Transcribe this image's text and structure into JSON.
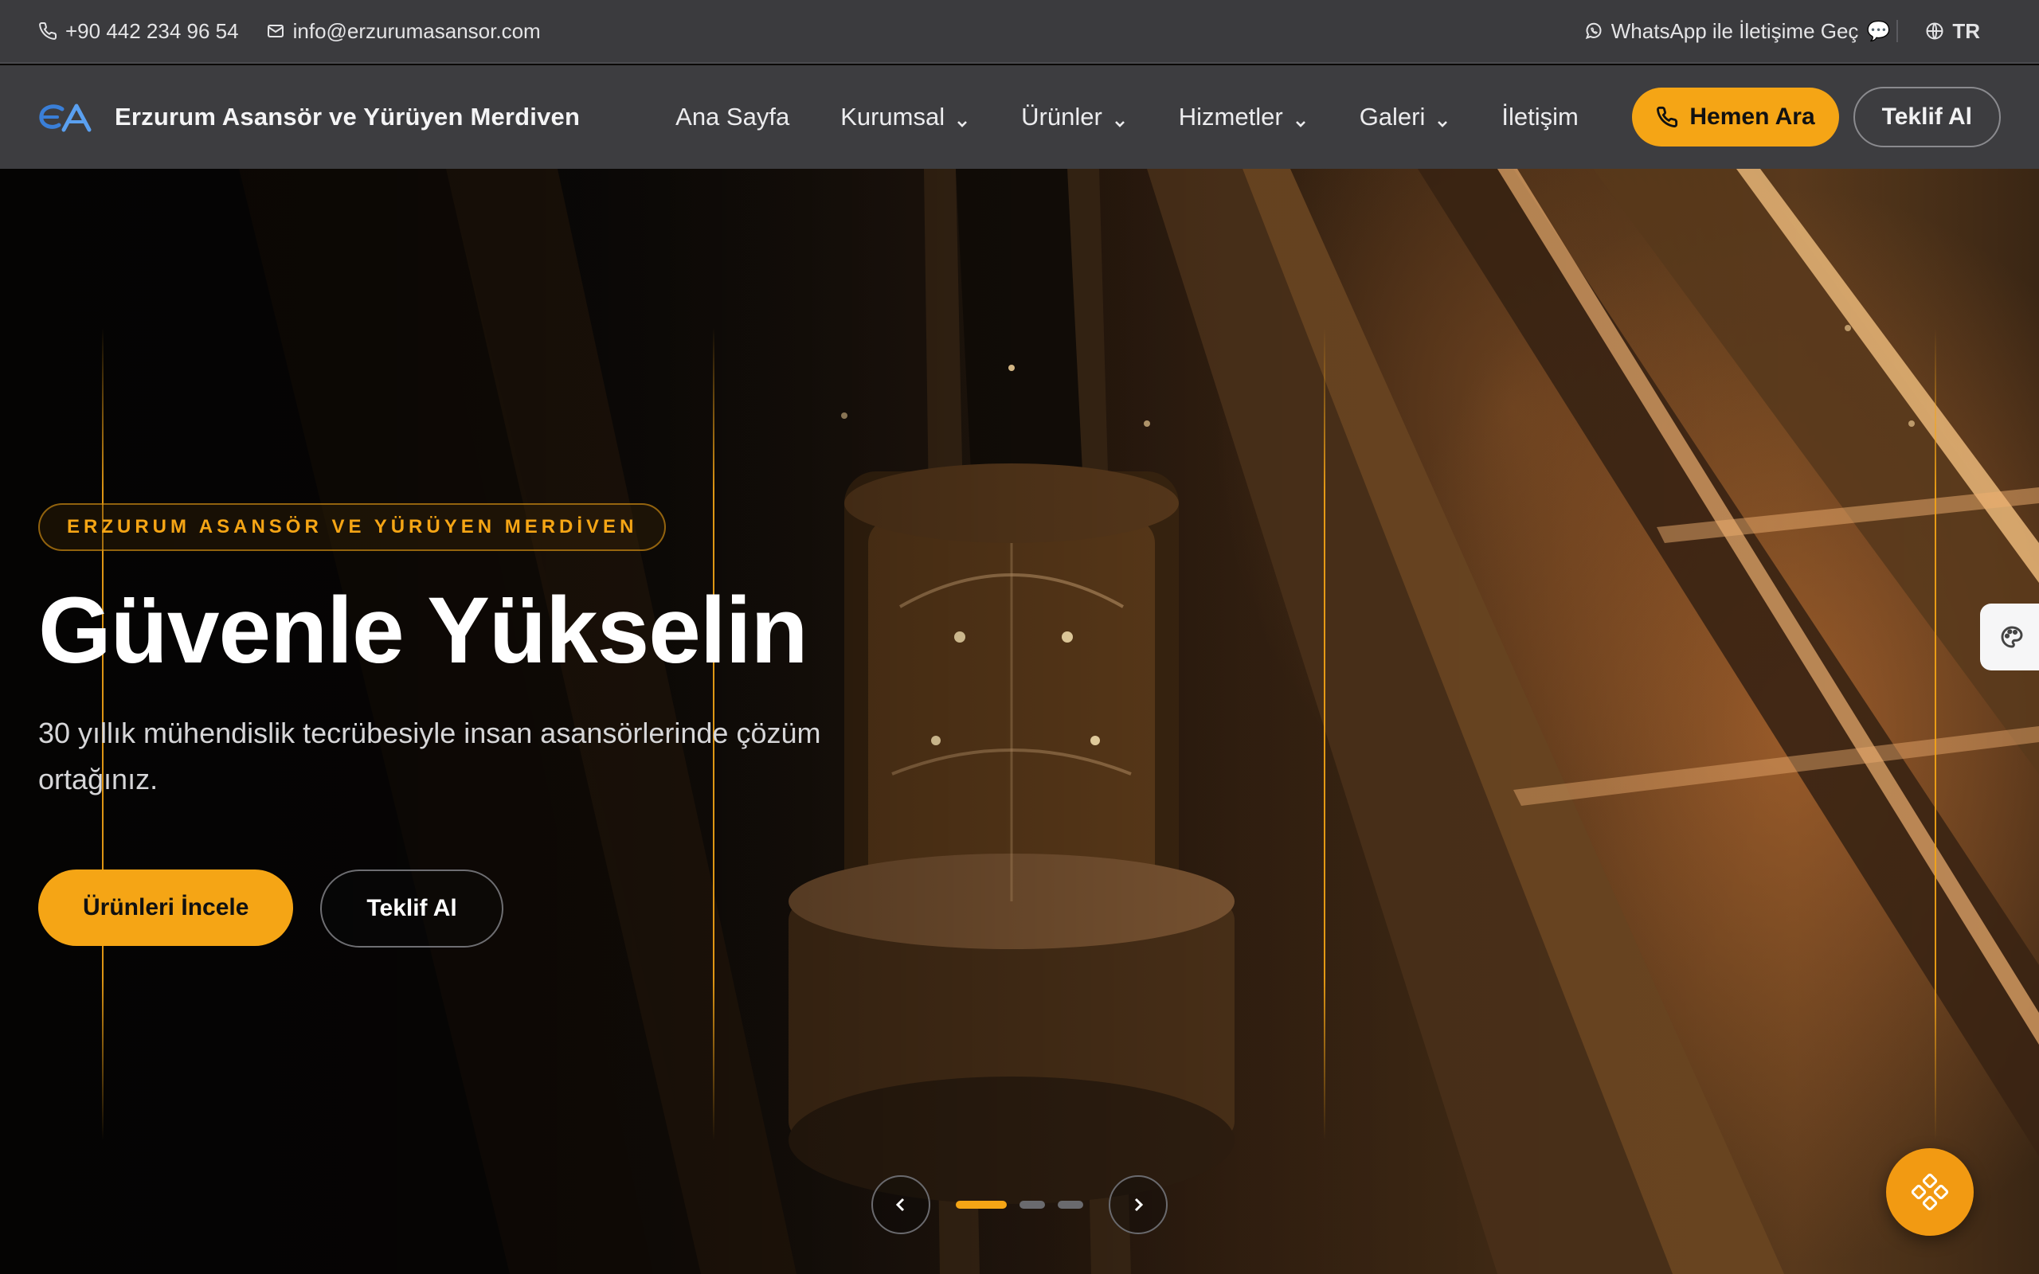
{
  "topbar": {
    "phone": "+90 442 234 96 54",
    "email": "info@erzurumasansor.com",
    "whatsapp": "WhatsApp ile İletişime Geç",
    "whatsapp_emoji": "💬",
    "language": "TR"
  },
  "nav": {
    "brand": "Erzurum Asansör ve Yürüyen Merdiven",
    "items": [
      {
        "label": "Ana Sayfa",
        "has_dropdown": false
      },
      {
        "label": "Kurumsal",
        "has_dropdown": true
      },
      {
        "label": "Ürünler",
        "has_dropdown": true
      },
      {
        "label": "Hizmetler",
        "has_dropdown": true
      },
      {
        "label": "Galeri",
        "has_dropdown": true
      },
      {
        "label": "İletişim",
        "has_dropdown": false
      }
    ],
    "call_label": "Hemen Ara",
    "quote_label": "Teklif Al"
  },
  "hero": {
    "eyebrow": "ERZURUM ASANSÖR VE YÜRÜYEN MERDİVEN",
    "title": "Güvenle Yükselin",
    "subtitle": "30 yıllık mühendislik tecrübesiyle insan asansörlerinde çözüm ortağınız.",
    "primary_cta": "Ürünleri İncele",
    "secondary_cta": "Teklif Al",
    "slides_total": 3,
    "active_slide": 1
  },
  "colors": {
    "accent": "#f5a515",
    "topbar_bg": "#3b3b3e",
    "nav_bg": "#3d3d40"
  },
  "icons": [
    "phone-icon",
    "mail-icon",
    "whatsapp-icon",
    "globe-icon",
    "chevron-down-icon",
    "chevron-left-icon",
    "chevron-right-icon",
    "palette-icon",
    "widget-icon"
  ]
}
